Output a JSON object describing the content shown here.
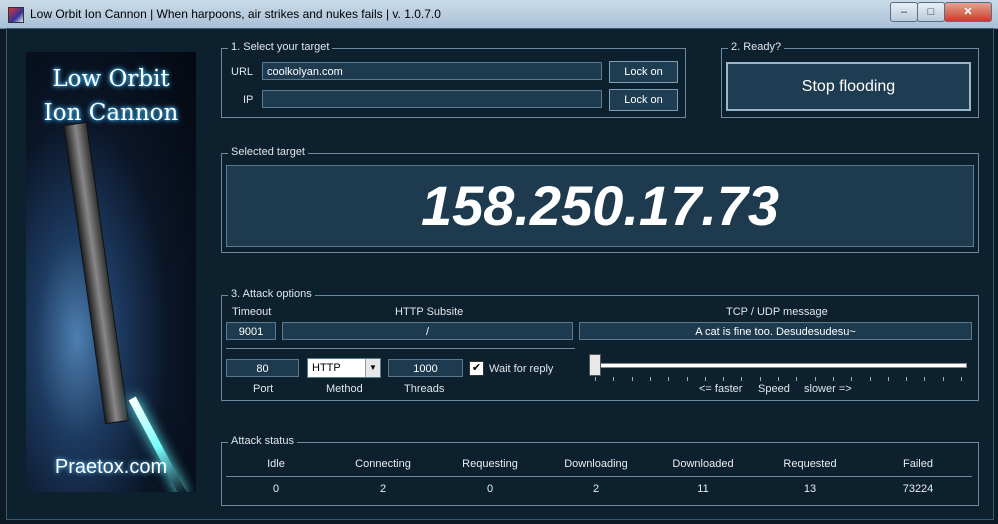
{
  "window": {
    "title": "Low Orbit Ion Cannon | When harpoons, air strikes and nukes fails | v. 1.0.7.0",
    "controls": {
      "minimize": "–",
      "maximize": "□",
      "close": "✕"
    }
  },
  "banner": {
    "line1": "Low Orbit",
    "line2": "Ion Cannon",
    "site": "Praetox.com"
  },
  "target": {
    "group_label": "1. Select your target",
    "url_label": "URL",
    "url_value": "coolkolyan.com",
    "ip_label": "IP",
    "ip_value": "",
    "lock_url": "Lock on",
    "lock_ip": "Lock on"
  },
  "ready": {
    "group_label": "2. Ready?",
    "button": "Stop flooding"
  },
  "selected": {
    "group_label": "Selected target",
    "ip": "158.250.17.73"
  },
  "attack": {
    "group_label": "3. Attack options",
    "timeout_label": "Timeout",
    "timeout_value": "9001",
    "subsite_label": "HTTP Subsite",
    "subsite_value": "/",
    "message_label": "TCP / UDP message",
    "message_value": "A cat is fine too. Desudesudesu~",
    "port_value": "80",
    "port_label": "Port",
    "method_value": "HTTP",
    "method_label": "Method",
    "threads_value": "1000",
    "threads_label": "Threads",
    "wait_label": "Wait for reply",
    "wait_checked": "✔",
    "faster": "<= faster",
    "speed": "Speed",
    "slower": "slower =>",
    "speed_level": 0
  },
  "status": {
    "group_label": "Attack status",
    "headers": [
      "Idle",
      "Connecting",
      "Requesting",
      "Downloading",
      "Downloaded",
      "Requested",
      "Failed"
    ],
    "values": [
      "0",
      "2",
      "0",
      "2",
      "11",
      "13",
      "73224"
    ]
  }
}
